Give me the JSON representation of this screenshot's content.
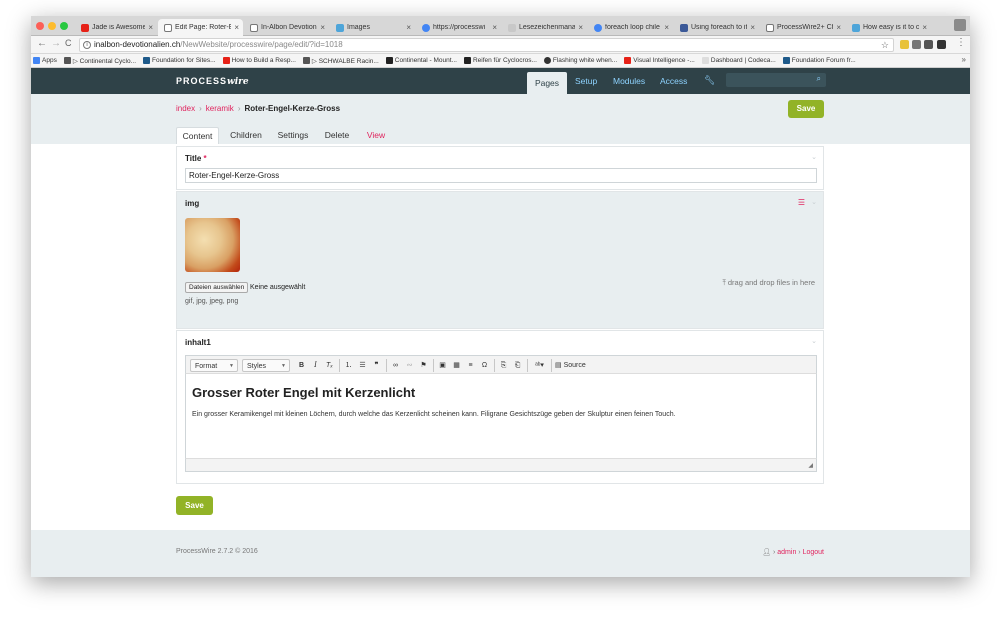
{
  "browser": {
    "tabs": [
      {
        "label": "Jade is Awesome",
        "color": "#e62117"
      },
      {
        "label": "Edit Page: Roter-E",
        "color": "#ffffff"
      },
      {
        "label": "In-Albon Devotion",
        "color": "#ffffff"
      },
      {
        "label": "Images",
        "color": "#4ea5d9"
      },
      {
        "label": "https://processwi",
        "color": "#4285f4"
      },
      {
        "label": "Lesezeichenmana",
        "color": "#d7d7d7"
      },
      {
        "label": "foreach loop chile",
        "color": "#4285f4"
      },
      {
        "label": "Using foreach to it",
        "color": "#3b5998"
      },
      {
        "label": "ProcessWire2+ Ch",
        "color": "#ffffff"
      },
      {
        "label": "How easy is it to c",
        "color": "#4ea5d9"
      }
    ],
    "url_domain": "inalbon-devotionalien.ch",
    "url_path": "/NewWebsite/processwire/page/edit/?id=1018",
    "bookmarks": [
      {
        "label": "Apps",
        "color": "#4285f4"
      },
      {
        "label": "▷ Continental Cyclo...",
        "color": "#555555"
      },
      {
        "label": "Foundation for Sites...",
        "color": "#1e5a8a"
      },
      {
        "label": "How to Build a Resp...",
        "color": "#e62117"
      },
      {
        "label": "▷ SCHWALBE Racin...",
        "color": "#555555"
      },
      {
        "label": "Continental - Mount...",
        "color": "#222222"
      },
      {
        "label": "Reifen für Cyclocros...",
        "color": "#222222"
      },
      {
        "label": "Flashing white when...",
        "color": "#333333"
      },
      {
        "label": "Visual Intelligence -...",
        "color": "#e62117"
      },
      {
        "label": "Dashboard | Codeca...",
        "color": "#f5f5f5"
      },
      {
        "label": "Foundation Forum fr...",
        "color": "#1e5a8a"
      }
    ],
    "more": "»"
  },
  "pw": {
    "logo_a": "PROCESS",
    "logo_b": "wire",
    "nav": {
      "pages": "Pages",
      "setup": "Setup",
      "modules": "Modules",
      "access": "Access"
    },
    "breadcrumb": {
      "index": "index",
      "keramik": "keramik",
      "current": "Roter-Engel-Kerze-Gross"
    },
    "save": "Save",
    "tabs": {
      "content": "Content",
      "children": "Children",
      "settings": "Settings",
      "delete": "Delete",
      "view": "View"
    }
  },
  "form": {
    "title_label": "Title",
    "title_required": "*",
    "title_value": "Roter-Engel-Kerze-Gross",
    "img_label": "img",
    "choose_file": "Dateien auswählen",
    "no_file": "Keine ausgewählt",
    "file_types": "gif, jpg, jpeg, png",
    "drag_drop": "drag and drop files in here",
    "inhalt_label": "inhalt1",
    "toolbar": {
      "format": "Format",
      "styles": "Styles",
      "bold": "B",
      "italic": "I",
      "source": "Source"
    },
    "editor_heading": "Grosser Roter Engel mit Kerzenlicht",
    "editor_text": "Ein grosser Keramikengel mit kleinen Löchern, durch welche das Kerzenlicht scheinen kann. Filigrane Gesichtszüge geben der Skulptur einen feinen Touch."
  },
  "footer": {
    "version": "ProcessWire 2.7.2 © 2016",
    "user": "admin",
    "logout": "Logout"
  }
}
